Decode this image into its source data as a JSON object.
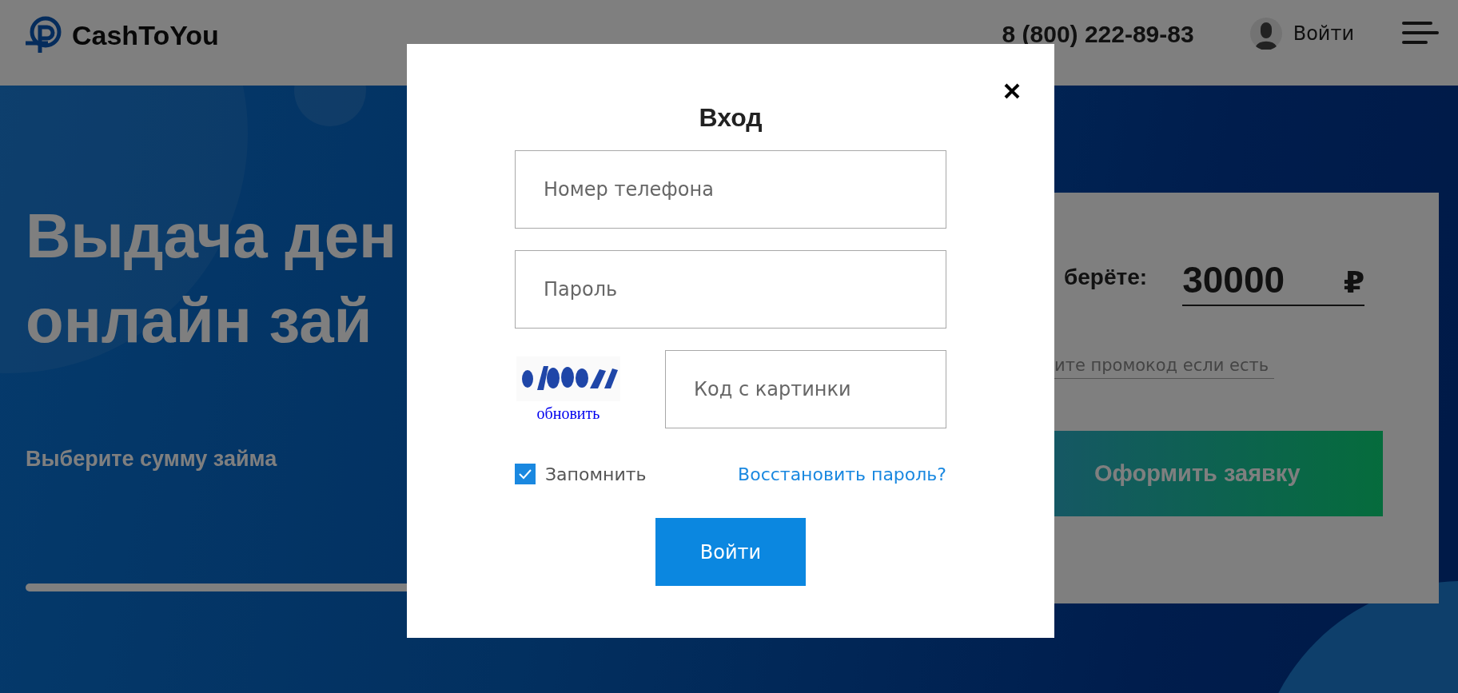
{
  "header": {
    "logo": "CashToYou",
    "phone": "8 (800) 222-89-83",
    "login": "Войти"
  },
  "hero": {
    "title_lines": [
      "Выдача ден",
      "онлайн зай"
    ],
    "subtitle": "Выберите сумму займа"
  },
  "loan_panel": {
    "amount_label": "берёте:",
    "amount": "30000",
    "currency": "₽",
    "promo_placeholder": "ите промокод если есть",
    "submit": "Оформить заявку"
  },
  "login_dialog": {
    "title": "Вход",
    "phone_placeholder": "Номер телефона",
    "password_placeholder": "Пароль",
    "captcha_refresh": "обновить",
    "captcha_placeholder": "Код с картинки",
    "remember": {
      "label": "Запомнить",
      "checked": true
    },
    "recover_link": "Восстановить пароль?",
    "submit": "Войти"
  }
}
